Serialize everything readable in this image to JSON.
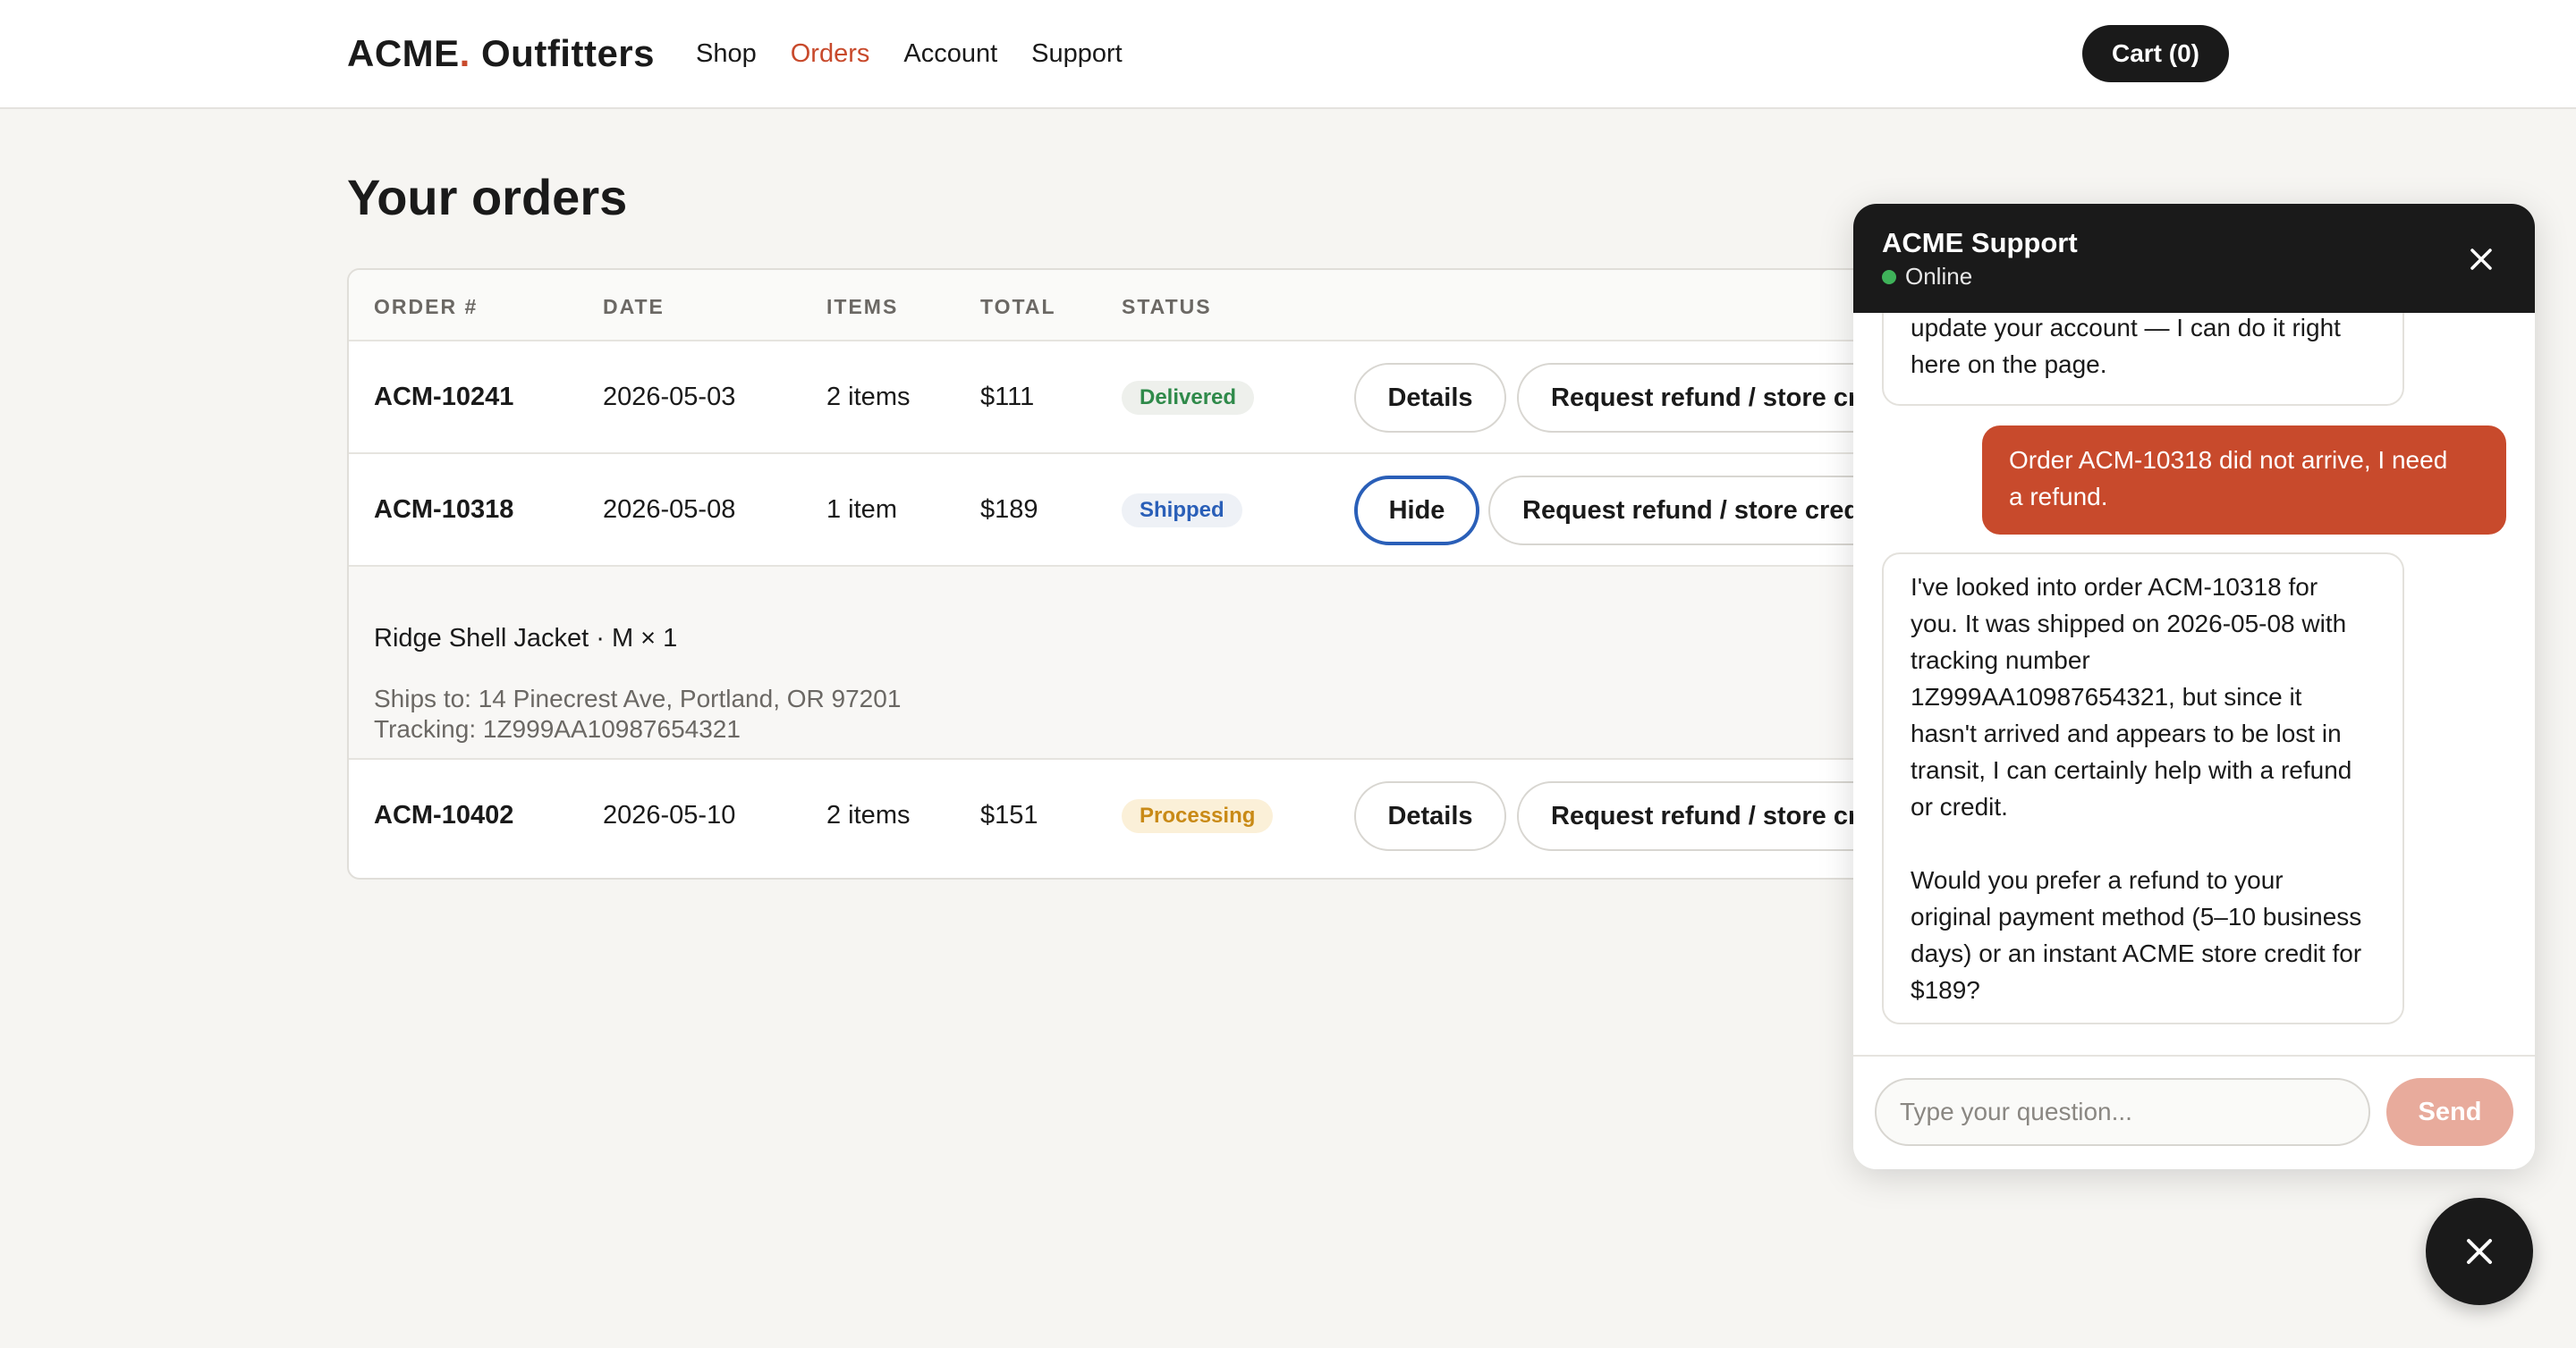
{
  "header": {
    "brand_main": "ACME",
    "brand_dot": ".",
    "brand_rest": " Outfitters",
    "nav": [
      {
        "label": "Shop",
        "active": false
      },
      {
        "label": "Orders",
        "active": true
      },
      {
        "label": "Account",
        "active": false
      },
      {
        "label": "Support",
        "active": false
      }
    ],
    "cart_label": "Cart (0)"
  },
  "page": {
    "title": "Your orders"
  },
  "table": {
    "columns": [
      "ORDER #",
      "DATE",
      "ITEMS",
      "TOTAL",
      "STATUS"
    ],
    "rows": [
      {
        "order": "ACM-10241",
        "date": "2026-05-03",
        "items": "2 items",
        "total": "$111",
        "status": "Delivered",
        "primary_button": "Details",
        "refund_button": "Request refund / store credit"
      },
      {
        "order": "ACM-10318",
        "date": "2026-05-08",
        "items": "1 item",
        "total": "$189",
        "status": "Shipped",
        "primary_button": "Hide",
        "refund_button": "Request refund / store credit"
      },
      {
        "order": "ACM-10402",
        "date": "2026-05-10",
        "items": "2 items",
        "total": "$151",
        "status": "Processing",
        "primary_button": "Details",
        "refund_button": "Request refund / store credit"
      }
    ],
    "expanded_detail": {
      "item": "Ridge Shell Jacket · M × 1",
      "ships_to": "Ships to: 14 Pinecrest Ave, Portland, OR 97201",
      "tracking": "Tracking: 1Z999AA10987654321"
    }
  },
  "chat": {
    "title": "ACME Support",
    "status": "Online",
    "messages": [
      {
        "role": "bot",
        "lines": [
          "update your account — I can do it right",
          "here on the page."
        ]
      },
      {
        "role": "user",
        "lines": [
          "Order ACM-10318 did not arrive, I need",
          "a refund."
        ]
      },
      {
        "role": "bot",
        "lines": [
          "I've looked into order ACM-10318 for",
          "you. It was shipped on 2026-05-08 with",
          "tracking number",
          "1Z999AA10987654321, but since it",
          "hasn't arrived and appears to be lost in",
          "transit, I can certainly help with a refund",
          "or credit.",
          "",
          "Would you prefer a refund to your",
          "original payment method (5–10 business",
          "days) or an instant ACME store credit for",
          "$189?"
        ]
      }
    ],
    "input_placeholder": "Type your question...",
    "send_label": "Send"
  },
  "icons": {
    "chat_close": "close-icon",
    "fab": "close-icon"
  },
  "colors": {
    "accent": "#c84a2c",
    "dark": "#1a1a1a",
    "online": "#3fb35a"
  }
}
